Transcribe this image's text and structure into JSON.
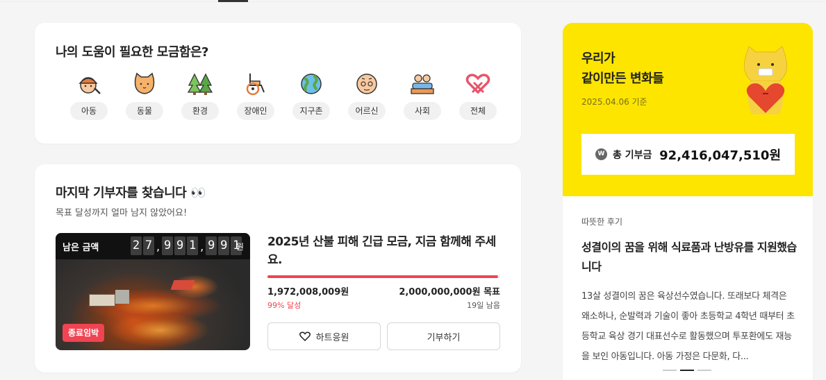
{
  "categories_card": {
    "title": "나의 도움이 필요한 모금함은?",
    "items": [
      {
        "label": "아동",
        "icon": "child-icon"
      },
      {
        "label": "동물",
        "icon": "cat-icon"
      },
      {
        "label": "환경",
        "icon": "trees-icon"
      },
      {
        "label": "장애인",
        "icon": "wheelchair-icon"
      },
      {
        "label": "지구촌",
        "icon": "globe-icon"
      },
      {
        "label": "어르신",
        "icon": "elder-icon"
      },
      {
        "label": "사회",
        "icon": "people-icon"
      },
      {
        "label": "전체",
        "icon": "heart-ribbon-icon"
      }
    ]
  },
  "fund_card": {
    "title": "마지막 기부자를 찾습니다 👀",
    "subtitle": "목표 달성까지 얼마 남지 않았어요!",
    "remaining_label": "남은 금액",
    "remaining_digits": [
      "2",
      "7",
      ",",
      "9",
      "9",
      "1",
      ",",
      "9",
      "9",
      "1"
    ],
    "remaining_unit": "원",
    "badge": "종료임박",
    "campaign_title": "2025년 산불 피해 긴급 모금, 지금 함께해 주세요.",
    "raised": "1,972,008,009원",
    "goal": "2,000,000,000원 목표",
    "percent_text": "99% 달성",
    "days_left": "19일 남음",
    "progress": 0.99,
    "heart_button": "하트응원",
    "donate_button": "기부하기"
  },
  "summary_card": {
    "heading_line1": "우리가",
    "heading_line2": "같이만든 변화들",
    "date": "2025.04.06 기준",
    "total_icon": "W",
    "total_label": "총 기부금",
    "total_value": "92,416,047,510원",
    "review_tag": "따뜻한 후기",
    "review_title": "성결이의 꿈을 위해 식료품과 난방유를 지원했습니다",
    "review_body": "13살 성결이의 꿈은 육상선수였습니다. 또래보다 체격은 왜소하나, 순발력과 기술이 좋아 초등학교 4학년 때부터 초등학교 육상 경기 대표선수로 활동했으며 투포환에도 재능을 보인 아동입니다. 아동 가정은 다문화, 다..."
  },
  "colors": {
    "accent": "#f04452",
    "yellow": "#fde500"
  }
}
